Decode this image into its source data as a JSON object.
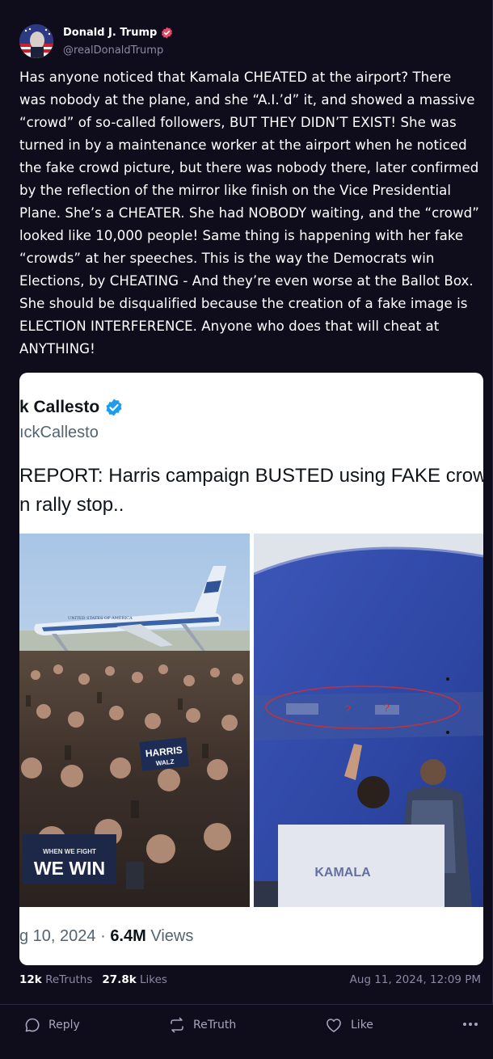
{
  "post": {
    "author": {
      "display_name": "Donald J. Trump",
      "handle": "@realDonaldTrump",
      "verified_icon": "verified-badge-icon",
      "accent_color": "#e64a6a"
    },
    "text": "Has anyone noticed that Kamala CHEATED at the airport? There was nobody at the plane, and she “A.I.’d” it, and showed a massive “crowd” of so-called followers, BUT THEY DIDN’T EXIST! She was turned in by a maintenance worker at the airport when he noticed the fake crowd picture, but there was nobody there, later confirmed by the reflection of the mirror like finish on the Vice Presidential Plane. She’s a CHEATER. She had NOBODY waiting, and the “crowd” looked like 10,000 people! Same thing is happening with her fake “crowds” at her speeches. This is the way the Democrats win Elections, by CHEATING - And they’re even worse at the Ballot Box. She should be disqualified because the creation of a fake image is ELECTION INTERFERENCE. Anyone who does that will cheat at ANYTHING!",
    "embedded": {
      "name": "k Callesto",
      "handle": "ıckCallesto",
      "text_line1": "REPORT: Harris campaign BUSTED using FAKE crow",
      "text_line2": "n rally stop..",
      "sign_harris": "HARRIS",
      "sign_walz": "WALZ",
      "sign_fight": "WHEN WE FIGHT",
      "sign_win": "WE WIN",
      "sign_kamala": "KAMALA",
      "plane_lettering": "UNITED STATES OF AMERICA",
      "footer_date": "g 10, 2024 · ",
      "footer_views_count": "6.4M",
      "footer_views_label": " Views"
    },
    "stats": {
      "retruths_count": "12k",
      "retruths_label": "ReTruths",
      "likes_count": "27.8k",
      "likes_label": "Likes"
    },
    "timestamp": "Aug 11, 2024, 12:09 PM"
  },
  "actions": {
    "reply_label": "Reply",
    "retruth_label": "ReTruth",
    "like_label": "Like",
    "more_icon": "more-icon"
  },
  "colors": {
    "background": "#0f0c1c",
    "muted_text": "#8e88a3",
    "card_background": "#ffffff"
  }
}
